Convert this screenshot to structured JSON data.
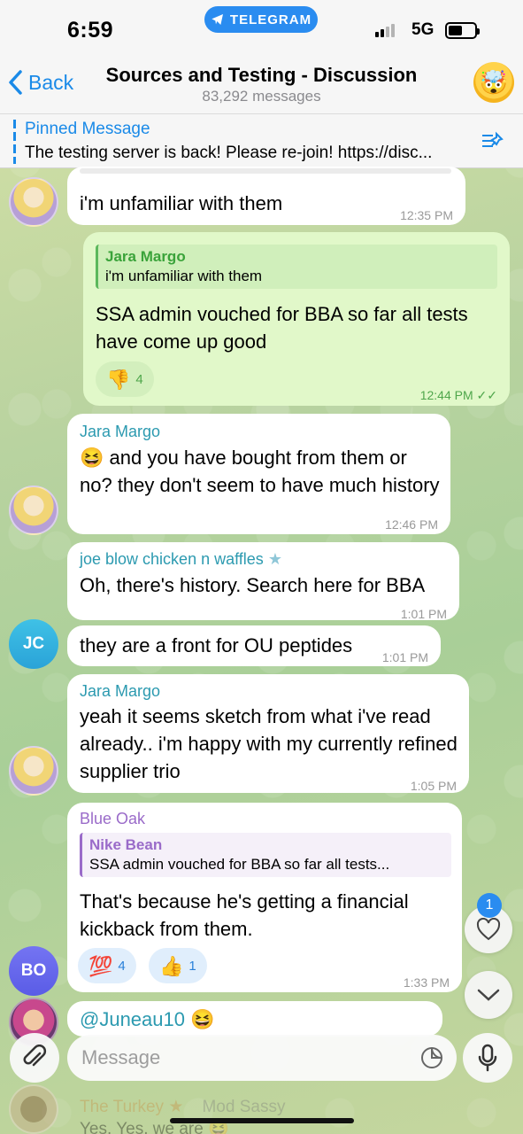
{
  "status": {
    "time": "6:59",
    "app_pill": "TELEGRAM",
    "network": "5G"
  },
  "header": {
    "back_label": "Back",
    "title": "Sources and Testing - Discussion",
    "subtitle": "83,292 messages"
  },
  "pinned": {
    "title": "Pinned Message",
    "text": "The testing server is back! Please re-join! https://disc..."
  },
  "messages": [
    {
      "text": "i'm unfamiliar with them",
      "time": "12:35 PM"
    },
    {
      "reply_name": "Jara Margo",
      "reply_text": "i'm unfamiliar with them",
      "text": "SSA admin vouched for BBA so far all tests have come up good",
      "reaction_emoji": "👎",
      "reaction_count": "4",
      "time": "12:44 PM"
    },
    {
      "sender": "Jara Margo",
      "emoji": "😆",
      "text": "and you have bought from them or no? they don't seem to have much history",
      "time": "12:46 PM"
    },
    {
      "sender": "joe blow chicken n waffles",
      "text": "Oh, there's history. Search here for BBA",
      "time": "1:01 PM"
    },
    {
      "text": "they are a front for OU peptides",
      "time": "1:01 PM",
      "avatar": "JC"
    },
    {
      "sender": "Jara Margo",
      "text": "yeah it seems sketch from what i've read already.. i'm happy with my currently refined supplier trio",
      "time": "1:05 PM"
    },
    {
      "sender": "Blue Oak",
      "reply_name": "Nike Bean",
      "reply_text": "SSA admin vouched for BBA so far all tests...",
      "text": "That's because he's getting a financial kickback from them.",
      "reactions": [
        {
          "emoji": "💯",
          "count": "4"
        },
        {
          "emoji": "👍",
          "count": "1"
        }
      ],
      "time": "1:33 PM",
      "avatar": "BO"
    },
    {
      "text": "@Juneau10 😆"
    },
    {
      "sender": "The Turkey",
      "sender2": "Mod Sassy",
      "text": "Yes. Yes, we are 😆"
    }
  ],
  "floating": {
    "unread_count": "1"
  },
  "input": {
    "placeholder": "Message"
  }
}
